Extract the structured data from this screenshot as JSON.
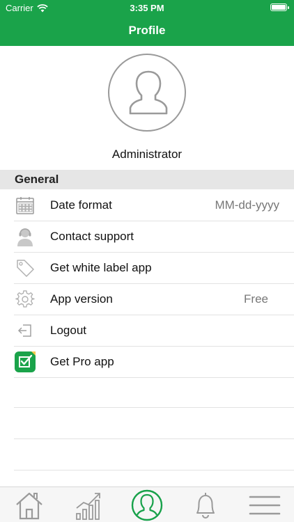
{
  "status_bar": {
    "carrier": "Carrier",
    "time": "3:35 PM"
  },
  "nav": {
    "title": "Profile"
  },
  "profile": {
    "username": "Administrator"
  },
  "section": {
    "title": "General"
  },
  "rows": [
    {
      "label": "Date format",
      "value": "MM-dd-yyyy",
      "icon": "calendar-icon"
    },
    {
      "label": "Contact support",
      "value": "",
      "icon": "support-agent-icon"
    },
    {
      "label": "Get white label app",
      "value": "",
      "icon": "tag-icon"
    },
    {
      "label": "App version",
      "value": "Free",
      "icon": "gear-icon"
    },
    {
      "label": "Logout",
      "value": "",
      "icon": "logout-icon"
    },
    {
      "label": "Get Pro app",
      "value": "",
      "icon": "pro-app-icon"
    }
  ],
  "tabs": [
    {
      "name": "home-tab",
      "icon": "home-icon",
      "active": false
    },
    {
      "name": "stats-tab",
      "icon": "chart-icon",
      "active": false
    },
    {
      "name": "profile-tab",
      "icon": "user-icon",
      "active": true
    },
    {
      "name": "notifications-tab",
      "icon": "bell-icon",
      "active": false
    },
    {
      "name": "menu-tab",
      "icon": "hamburger-icon",
      "active": false
    }
  ],
  "colors": {
    "brand": "#1aa34a",
    "active_tab": "#17a14a",
    "inactive_tab": "#9a9a9a"
  }
}
